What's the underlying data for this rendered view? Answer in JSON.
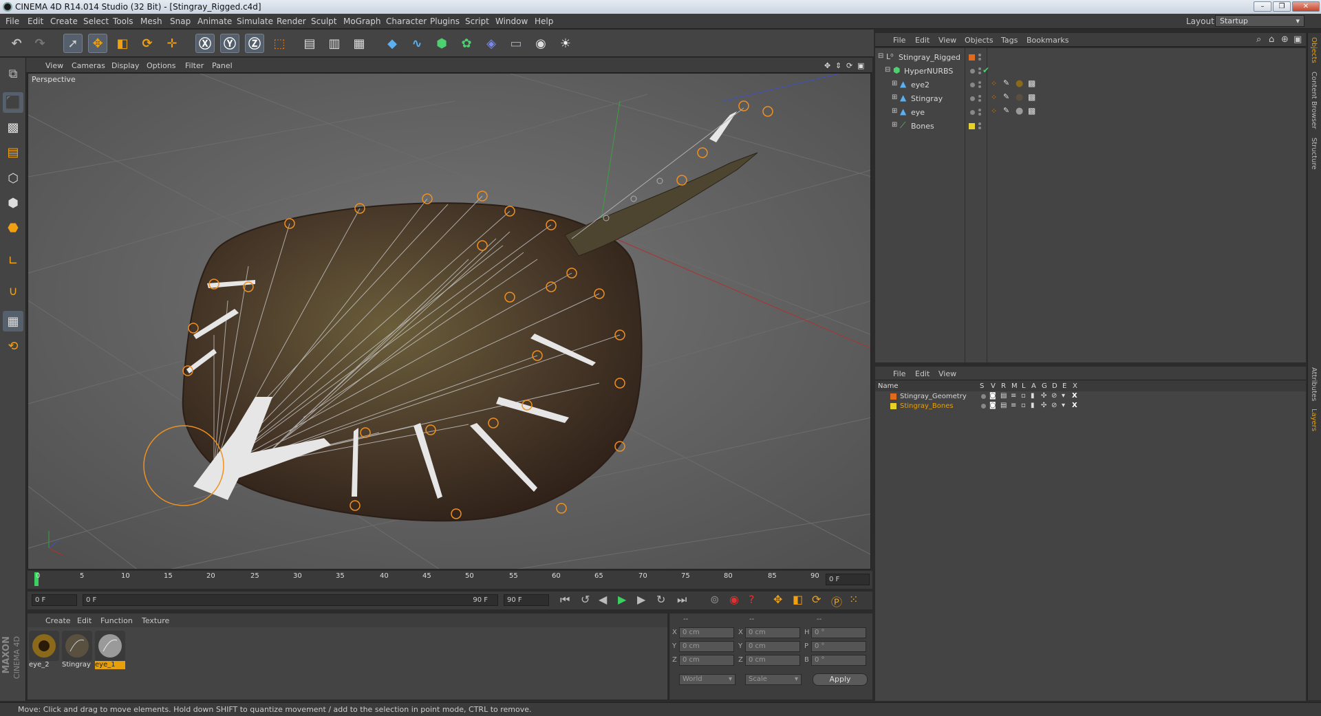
{
  "window": {
    "title": "CINEMA 4D R14.014 Studio (32 Bit) - [Stingray_Rigged.c4d]"
  },
  "menus": [
    "File",
    "Edit",
    "Create",
    "Select",
    "Tools",
    "Mesh",
    "Snap",
    "Animate",
    "Simulate",
    "Render",
    "Sculpt",
    "MoGraph",
    "Character",
    "Plugins",
    "Script",
    "Window",
    "Help"
  ],
  "layout": {
    "label": "Layout:",
    "value": "Startup"
  },
  "viewport": {
    "menus": [
      "View",
      "Cameras",
      "Display",
      "Options",
      "Filter",
      "Panel"
    ],
    "label": "Perspective"
  },
  "timeline": {
    "ticks": [
      "0",
      "5",
      "10",
      "15",
      "20",
      "25",
      "30",
      "35",
      "40",
      "45",
      "50",
      "55",
      "60",
      "65",
      "70",
      "75",
      "80",
      "85",
      "90"
    ],
    "current_frame": "0 F",
    "start_frame": "0 F",
    "range_start": "0 F",
    "range_end": "90 F",
    "end_frame": "90 F"
  },
  "material_manager": {
    "menus": [
      "Create",
      "Edit",
      "Function",
      "Texture"
    ],
    "materials": [
      {
        "name": "eye_2",
        "selected": false
      },
      {
        "name": "Stingray",
        "selected": false
      },
      {
        "name": "eye_1",
        "selected": true
      }
    ]
  },
  "coordinates": {
    "col1_header": "--",
    "col2_header": "--",
    "col3_header": "--",
    "rows": [
      {
        "l1": "X",
        "v1": "0 cm",
        "l2": "X",
        "v2": "0 cm",
        "l3": "H",
        "v3": "0 °"
      },
      {
        "l1": "Y",
        "v1": "0 cm",
        "l2": "Y",
        "v2": "0 cm",
        "l3": "P",
        "v3": "0 °"
      },
      {
        "l1": "Z",
        "v1": "0 cm",
        "l2": "Z",
        "v2": "0 cm",
        "l3": "B",
        "v3": "0 °"
      }
    ],
    "mode1": "World",
    "mode2": "Scale",
    "apply": "Apply"
  },
  "object_manager": {
    "menus": [
      "File",
      "Edit",
      "View",
      "Objects",
      "Tags",
      "Bookmarks"
    ],
    "objects": [
      {
        "name": "Stingray_Rigged",
        "color": "#e06a1e"
      },
      {
        "name": "HyperNURBS",
        "color": ""
      },
      {
        "name": "eye2",
        "color": ""
      },
      {
        "name": "Stingray",
        "color": ""
      },
      {
        "name": "eye",
        "color": ""
      },
      {
        "name": "Bones",
        "color": "#e8d22a"
      }
    ]
  },
  "layer_manager": {
    "menus": [
      "File",
      "Edit",
      "View"
    ],
    "columns": [
      "Name",
      "S",
      "V",
      "R",
      "M",
      "L",
      "A",
      "G",
      "D",
      "E",
      "X"
    ],
    "layers": [
      {
        "name": "Stingray_Geometry",
        "color": "#e06a1e",
        "active": false
      },
      {
        "name": "Stingray_Bones",
        "color": "#e8d22a",
        "active": true
      }
    ]
  },
  "right_tabs": [
    "Objects",
    "Content Browser",
    "Structure",
    "Attributes",
    "Layers"
  ],
  "branding": {
    "brand": "MAXON",
    "product": "CINEMA 4D"
  },
  "status": "Move: Click and drag to move elements. Hold down SHIFT to quantize movement / add to the selection in point mode, CTRL to remove.",
  "colors": {
    "accent": "#e8a00a",
    "selection": "#e8a00a"
  }
}
